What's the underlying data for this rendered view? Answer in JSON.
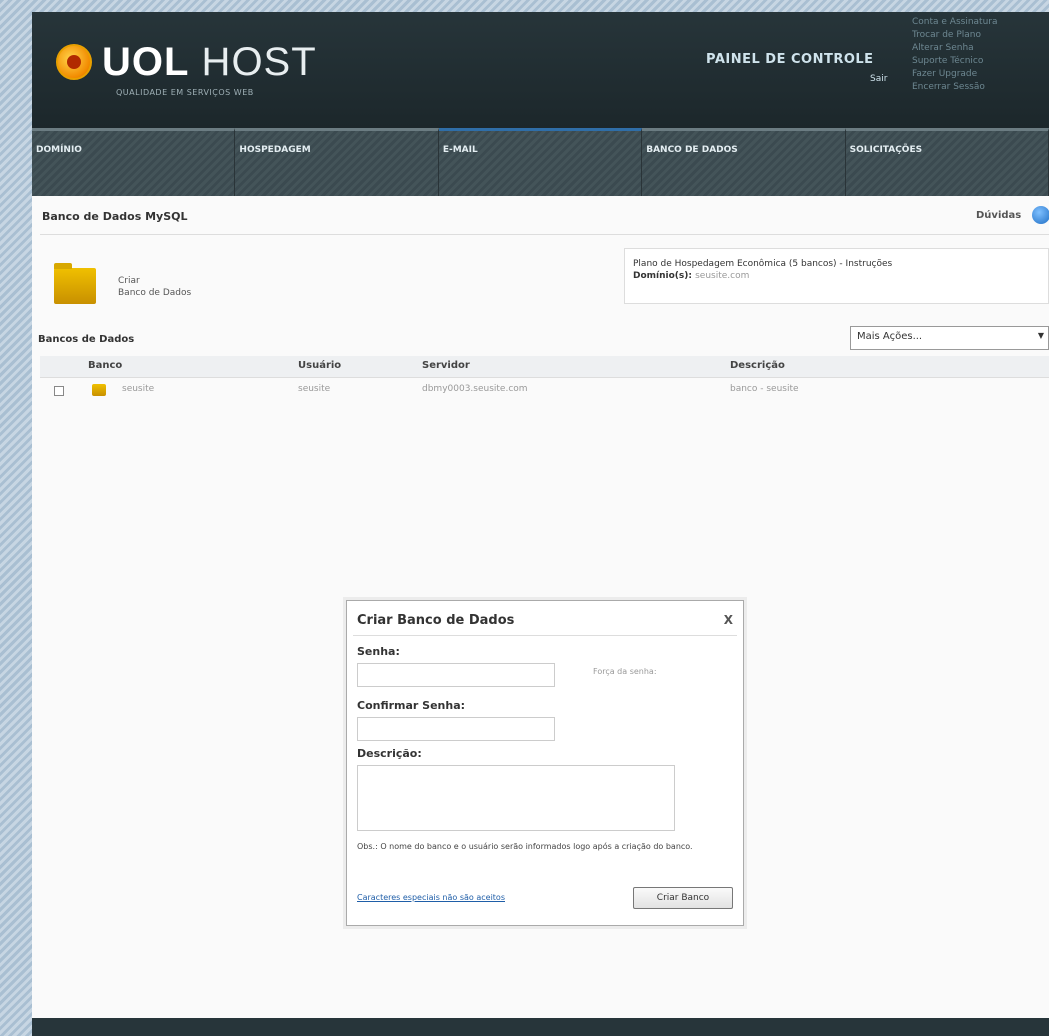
{
  "header": {
    "brand_strong": "UOL",
    "brand_light": " HOST",
    "tagline": "QUALIDADE EM SERVIÇOS WEB",
    "panel_title": "PAINEL DE CONTROLE",
    "panel_sub": "Sair",
    "quick_links": [
      "Conta e Assinatura",
      "Trocar de Plano",
      "Alterar Senha",
      "Suporte Técnico",
      "Fazer Upgrade",
      "Encerrar Sessão"
    ]
  },
  "nav": {
    "tabs": [
      {
        "label": "DOMÍNIO"
      },
      {
        "label": "HOSPEDAGEM"
      },
      {
        "label": "E-MAIL"
      },
      {
        "label": "BANCO DE DADOS"
      },
      {
        "label": "SOLICITAÇÕES"
      }
    ],
    "active_index": 3
  },
  "page": {
    "title": "Banco de Dados MySQL",
    "help": "Dúvidas",
    "create_line1": "Criar",
    "create_line2": "Banco de Dados"
  },
  "plan": {
    "line1": "Plano de Hospedagem Econômica (5 bancos) - Instruções",
    "line2_label": "Domínio(s): ",
    "line2_value": "seusite.com"
  },
  "databases": {
    "section_title": "Bancos de Dados",
    "more_actions": "Mais Ações...",
    "columns": [
      "Banco",
      "Usuário",
      "Servidor",
      "Descrição"
    ],
    "rows": [
      {
        "bank": "seusite",
        "user": "seusite",
        "server": "dbmy0003.seusite.com",
        "description": "banco - seusite"
      }
    ]
  },
  "modal": {
    "title": "Criar Banco de Dados",
    "close": "X",
    "password_label": "Senha:",
    "password_hint": "Força da senha:",
    "confirm_label": "Confirmar Senha:",
    "description_label": "Descrição:",
    "note": "Obs.: O nome do banco e o usuário serão informados logo após a criação do banco.",
    "special_chars_link": "Caracteres especiais não são aceitos",
    "create_button": "Criar Banco"
  }
}
